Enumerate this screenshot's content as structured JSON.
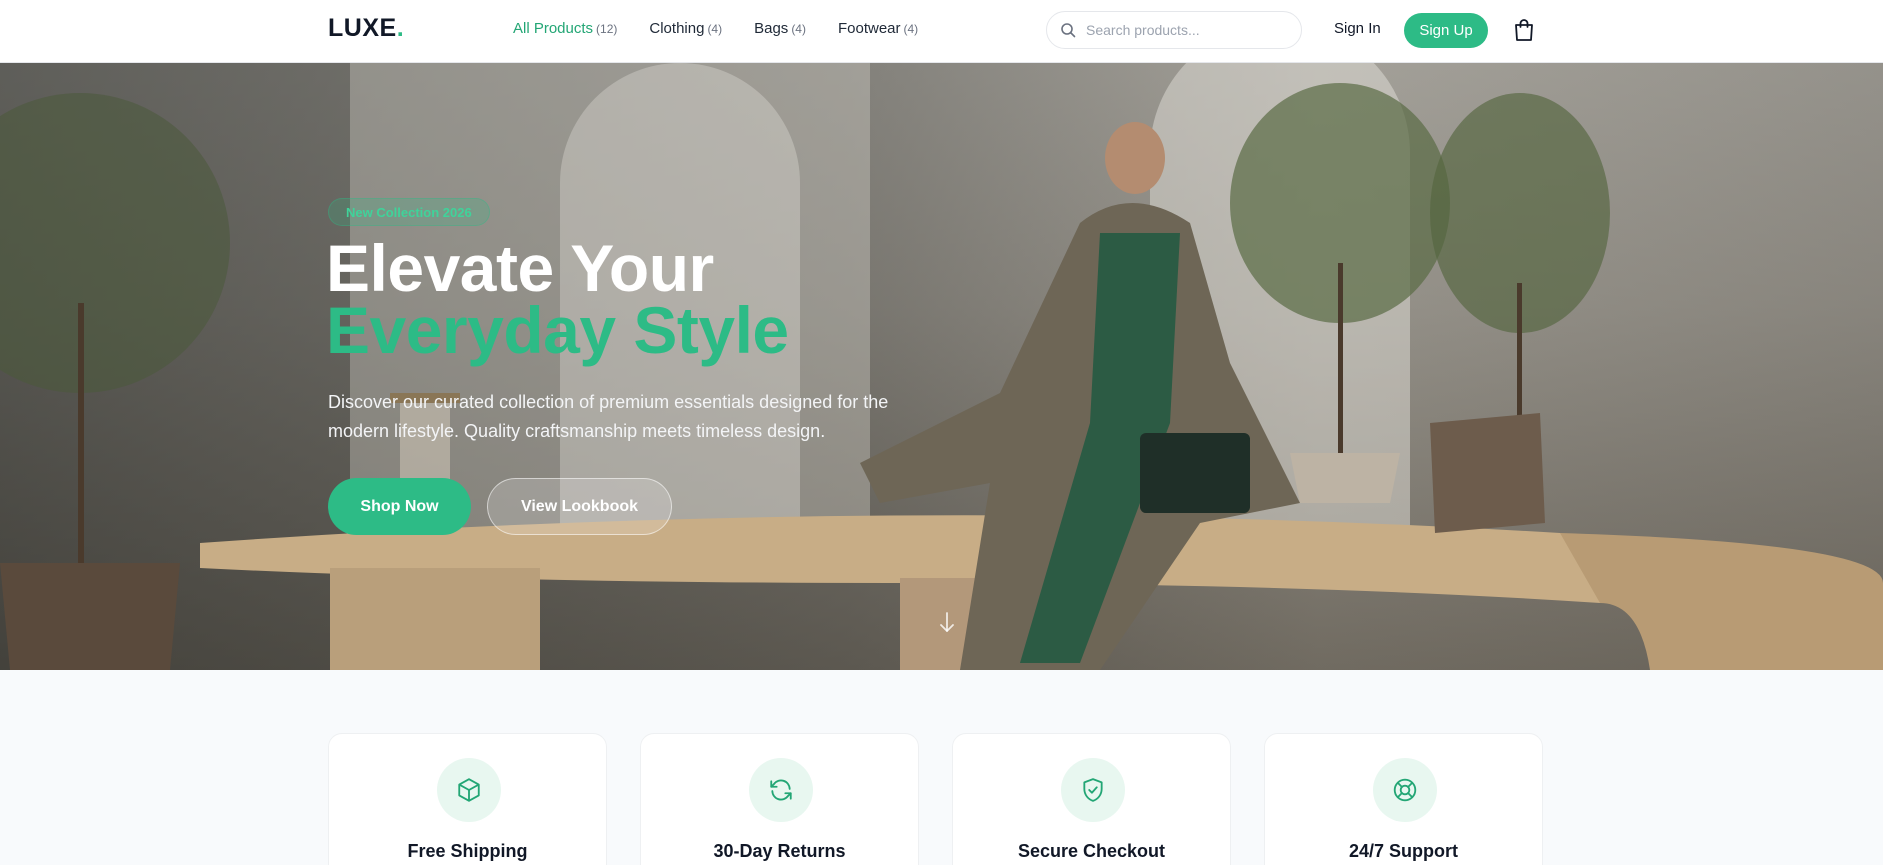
{
  "brand": {
    "name": "LUXE",
    "dot": "."
  },
  "nav": {
    "items": [
      {
        "label": "All Products",
        "count": "(12)",
        "active": true
      },
      {
        "label": "Clothing",
        "count": "(4)",
        "active": false
      },
      {
        "label": "Bags",
        "count": "(4)",
        "active": false
      },
      {
        "label": "Footwear",
        "count": "(4)",
        "active": false
      }
    ]
  },
  "search": {
    "placeholder": "Search products...",
    "value": "",
    "icon": "search-icon"
  },
  "auth": {
    "signin_label": "Sign In",
    "signup_label": "Sign Up"
  },
  "cart": {
    "icon": "shopping-bag-icon"
  },
  "hero": {
    "badge": "New Collection 2026",
    "title_line1": "Elevate Your",
    "title_line2": "Everyday Style",
    "description": "Discover our curated collection of premium essentials designed for the modern lifestyle. Quality craftsmanship meets timeless design.",
    "primary_cta": "Shop Now",
    "secondary_cta": "View Lookbook",
    "scroll_icon": "arrow-down-icon"
  },
  "features": [
    {
      "title": "Free Shipping",
      "icon": "box-icon"
    },
    {
      "title": "30-Day Returns",
      "icon": "refresh-icon"
    },
    {
      "title": "Secure Checkout",
      "icon": "shield-check-icon"
    },
    {
      "title": "24/7 Support",
      "icon": "lifebuoy-icon"
    }
  ],
  "colors": {
    "accent": "#2dbb86",
    "accent_text": "#23a675",
    "text": "#111827",
    "muted": "#6b7280"
  }
}
